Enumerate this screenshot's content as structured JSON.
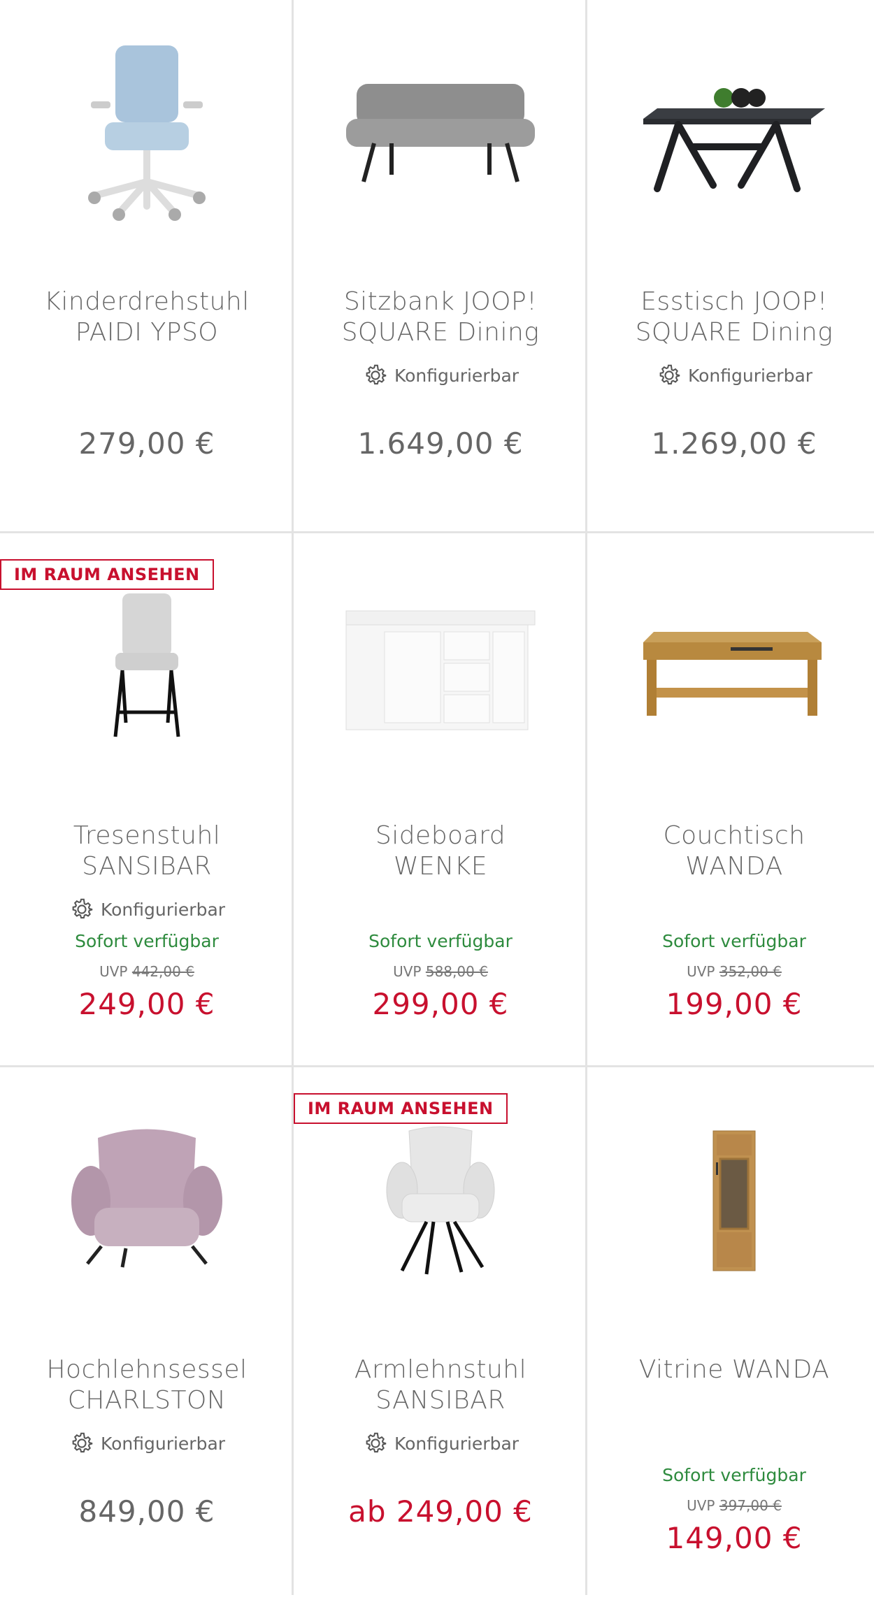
{
  "products": [
    {
      "title_1": "Kinderdrehstuhl",
      "title_2": "PAIDI YPSO",
      "config": "",
      "stock": "",
      "uvp_label": "",
      "uvp": "",
      "price": "279,00 €",
      "sale": false,
      "badge": "",
      "icon": "office-chair-icon"
    },
    {
      "title_1": "Sitzbank JOOP!",
      "title_2": "SQUARE Dining",
      "config": "Konfigurierbar",
      "stock": "",
      "uvp_label": "",
      "uvp": "",
      "price": "1.649,00 €",
      "sale": false,
      "badge": "",
      "icon": "bench-icon"
    },
    {
      "title_1": "Esstisch JOOP!",
      "title_2": "SQUARE Dining",
      "config": "Konfigurierbar",
      "stock": "",
      "uvp_label": "",
      "uvp": "",
      "price": "1.269,00 €",
      "sale": false,
      "badge": "",
      "icon": "dining-table-icon"
    },
    {
      "title_1": "Tresenstuhl",
      "title_2": "SANSIBAR",
      "config": "Konfigurierbar",
      "stock": "Sofort verfügbar",
      "uvp_label": "UVP",
      "uvp": "442,00 €",
      "price": "249,00 €",
      "sale": true,
      "badge": "IM RAUM ANSEHEN",
      "icon": "bar-stool-icon"
    },
    {
      "title_1": "Sideboard",
      "title_2": "WENKE",
      "config": "",
      "stock": "Sofort verfügbar",
      "uvp_label": "UVP",
      "uvp": "588,00 €",
      "price": "299,00 €",
      "sale": true,
      "badge": "",
      "icon": "sideboard-icon"
    },
    {
      "title_1": "Couchtisch",
      "title_2": "WANDA",
      "config": "",
      "stock": "Sofort verfügbar",
      "uvp_label": "UVP",
      "uvp": "352,00 €",
      "price": "199,00 €",
      "sale": true,
      "badge": "",
      "icon": "coffee-table-icon"
    },
    {
      "title_1": "Hochlehnsessel",
      "title_2": "CHARLSTON",
      "config": "Konfigurierbar",
      "stock": "",
      "uvp_label": "",
      "uvp": "",
      "price": "849,00 €",
      "sale": false,
      "badge": "",
      "icon": "armchair-icon"
    },
    {
      "title_1": "Armlehnstuhl",
      "title_2": "SANSIBAR",
      "config": "Konfigurierbar",
      "stock": "",
      "uvp_label": "",
      "uvp": "",
      "price": "ab 249,00 €",
      "sale": true,
      "badge": "IM RAUM ANSEHEN",
      "icon": "dining-armchair-icon"
    },
    {
      "title_1": "Vitrine WANDA",
      "title_2": "",
      "config": "",
      "stock": "Sofort verfügbar",
      "uvp_label": "UVP",
      "uvp": "397,00 €",
      "price": "149,00 €",
      "sale": true,
      "badge": "",
      "icon": "display-cabinet-icon"
    }
  ],
  "colors": {
    "sale": "#c8102e",
    "stock": "#2e8b3e",
    "text": "#666666",
    "divider": "#e3e3e3"
  }
}
